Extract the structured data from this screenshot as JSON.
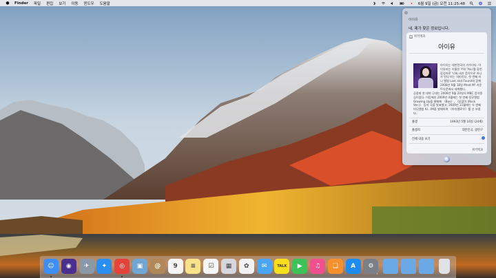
{
  "menubar": {
    "app_name": "Finder",
    "items": [
      "파일",
      "편집",
      "보기",
      "이동",
      "윈도우",
      "도움말"
    ],
    "clock": "6월 9일 (금) 오전 11:25:48"
  },
  "siri": {
    "question": "아이유",
    "answer": "네, 제가 찾은 정보입니다.",
    "card": {
      "source": "위키백과",
      "title": "아이유",
      "intro": "아이유는 대한민국의 가수이다. 아이유라는 이름은 'I'와 'You'를 합친 합성어로 '너와 내가 음악으로 하나가 된다'라는 의미이다. 첫 번째 미니 앨범 Lost and Found와 함께 2008년 9월 18일 Mnet M! 카운트다운에서 데뷔했다.",
      "body": "공중파 첫 데뷔 무대는 2008년 9월 20일의 MBC 음악중심이었다. 이듬해인 2009년 4월에는 첫 번째 정규앨범 Growing Up을 발매해 〈Boo〉, 〈있잖아 (Rock Ver.)〉 등의 곡을 발표했고, 2009년 11월에는 두 번째 미니앨범 IU...IM을 발매하며 〈마쉬멜로우〉를 선 보였다.",
      "rows": [
        {
          "label": "출생",
          "value": "1993년 5월 16일 (24세)"
        },
        {
          "label": "출생지",
          "value": "대한민국, 광진구"
        },
        {
          "label": "전체 내용 보기",
          "value": ""
        }
      ],
      "footer": "위키백과"
    }
  },
  "dock": {
    "apps": [
      {
        "name": "Finder",
        "glyph": "☺",
        "color": "#3d8ff5"
      },
      {
        "name": "Siri",
        "glyph": "◉",
        "color": "#4b2f8e"
      },
      {
        "name": "Launchpad",
        "glyph": "✈",
        "color": "#8b98a8"
      },
      {
        "name": "Safari",
        "glyph": "✦",
        "color": "#2b8ef0"
      },
      {
        "name": "Chrome",
        "glyph": "◎",
        "color": "#e5433a"
      },
      {
        "name": "Preview",
        "glyph": "▣",
        "color": "#6fa6d6"
      },
      {
        "name": "Contacts",
        "glyph": "@",
        "color": "#b0885a"
      },
      {
        "name": "Calendar",
        "glyph": "9",
        "color": "#f5f5f5"
      },
      {
        "name": "Notes",
        "glyph": "≡",
        "color": "#f8e28a"
      },
      {
        "name": "Reminders",
        "glyph": "☑",
        "color": "#f6f6f6"
      },
      {
        "name": "Photo Booth",
        "glyph": "▦",
        "color": "#d6d8de"
      },
      {
        "name": "Photos",
        "glyph": "✿",
        "color": "#f2f2f2"
      },
      {
        "name": "Messages",
        "glyph": "✉",
        "color": "#49a5f5"
      },
      {
        "name": "KakaoTalk",
        "glyph": "TALK",
        "color": "#f7df1e"
      },
      {
        "name": "FaceTime",
        "glyph": "▶",
        "color": "#3cc45a"
      },
      {
        "name": "iTunes",
        "glyph": "♫",
        "color": "#f24f8e"
      },
      {
        "name": "iBooks",
        "glyph": "❑",
        "color": "#f5902c"
      },
      {
        "name": "App Store",
        "glyph": "A",
        "color": "#1d8cf5"
      },
      {
        "name": "System Preferences",
        "glyph": "⚙",
        "color": "#7a7f88"
      }
    ],
    "folders": [
      {
        "name": "Applications folder",
        "color": "#6aa8e6"
      },
      {
        "name": "Documents folder",
        "color": "#6aa8e6"
      },
      {
        "name": "Downloads folder",
        "color": "#6aa8e6"
      },
      {
        "name": "Trash",
        "color": "#e0e2e6"
      }
    ]
  }
}
